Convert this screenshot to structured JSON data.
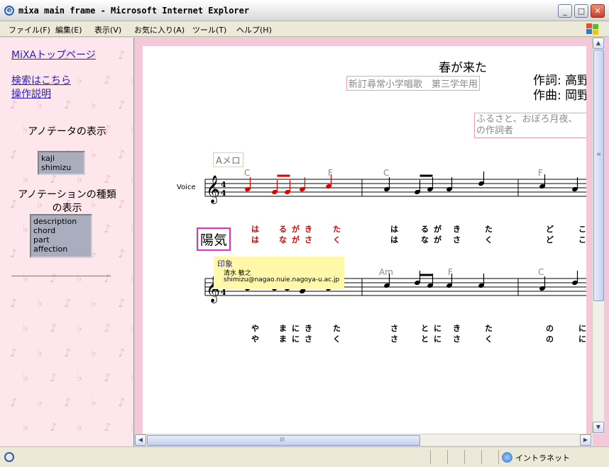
{
  "window": {
    "title": "mixa main frame - Microsoft Internet Explorer",
    "minimize_glyph": "_",
    "maximize_glyph": "□",
    "close_glyph": "✕"
  },
  "menu": [
    "ファイル(F)",
    "編集(E)",
    "表示(V)",
    "お気に入り(A)",
    "ツール(T)",
    "ヘルプ(H)"
  ],
  "sidebar": {
    "links": [
      "MiXAトップページ",
      "検索はこちら",
      "操作説明"
    ],
    "annotator_heading": "アノテータの表示",
    "annotators": [
      "kaji",
      "shimizu"
    ],
    "annotation_type_heading_line1": "アノテーションの種類",
    "annotation_type_heading_line2": "の表示",
    "annotation_types": [
      "description",
      "chord",
      "part",
      "affection"
    ],
    "background_glyphs": [
      "♪",
      "♭"
    ]
  },
  "score": {
    "title": "春が来た",
    "subtitle": "新訂尋常小学唱歌　第三学年用",
    "lyricist": "作詞: 高野",
    "composer": "作曲: 岡野",
    "description_line1": "ふるさと、おぼろ月夜、",
    "description_line2": "の作詞者",
    "part_label": "Aメロ",
    "voice_label": "Voice",
    "mood": "陽気",
    "tooltip": {
      "title": "印象",
      "annotator": "清水 敏之",
      "email": "shimizu@nagao.nuie.nagoya-u.ac.jp"
    },
    "time_signature": [
      "4",
      "4"
    ],
    "system1_chords": [
      "C",
      "F",
      "C",
      "F"
    ],
    "system2_chords": [
      "Am",
      "F",
      "C"
    ],
    "system1_lyrics_row1": [
      "は",
      "る",
      "が",
      "き",
      "た",
      "は",
      "る",
      "が",
      "き",
      "た",
      "ど",
      "こ"
    ],
    "system1_lyrics_row2": [
      "は",
      "な",
      "が",
      "さ",
      "く",
      "は",
      "な",
      "が",
      "さ",
      "く",
      "ど",
      "こ"
    ],
    "system2_lyrics_row1": [
      "や",
      "ま",
      "に",
      "き",
      "た",
      "さ",
      "と",
      "に",
      "き",
      "た",
      "の",
      "に"
    ],
    "system2_lyrics_row2": [
      "や",
      "ま",
      "に",
      "さ",
      "く",
      "さ",
      "と",
      "に",
      "さ",
      "く",
      "の",
      "に"
    ],
    "highlight_color": "#e00000",
    "scroll_grip": "III"
  },
  "status": {
    "zone": "イントラネット"
  }
}
